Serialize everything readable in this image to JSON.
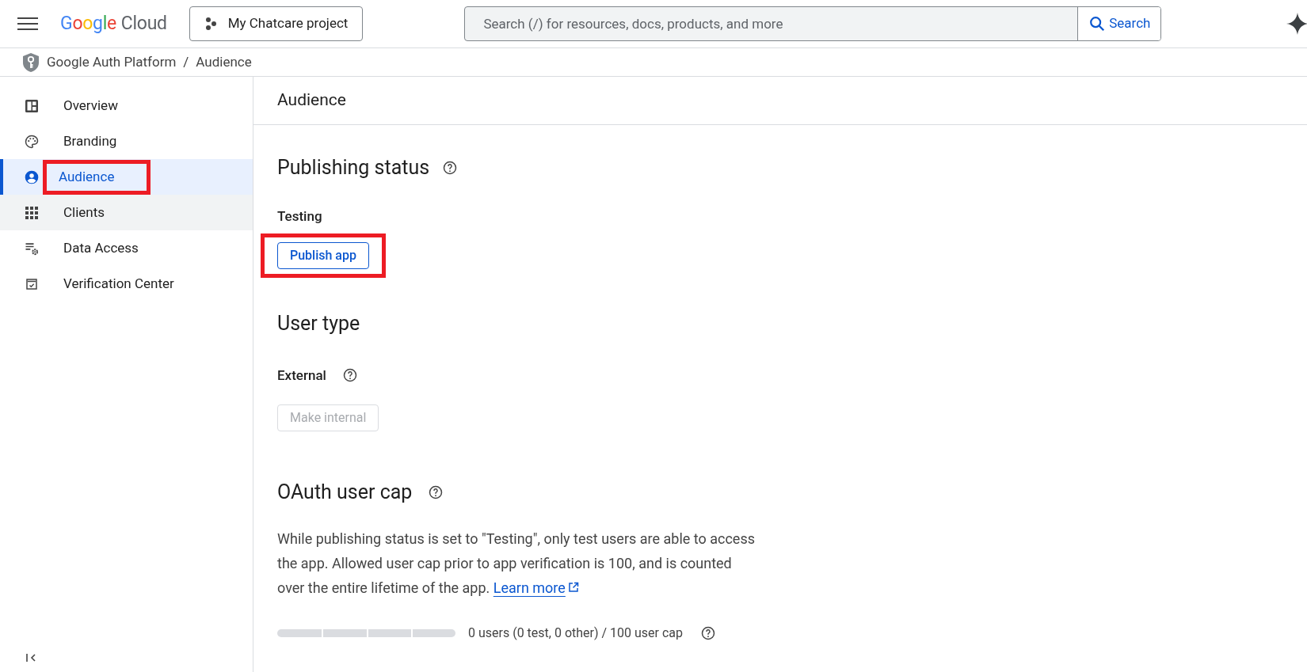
{
  "header": {
    "logo": {
      "brand": "Google",
      "product": "Cloud"
    },
    "project": "My Chatcare project",
    "search": {
      "placeholder": "Search (/) for resources, docs, products, and more",
      "button": "Search"
    }
  },
  "breadcrumb": [
    "Google Auth Platform",
    "/",
    "Audience"
  ],
  "sidebar": {
    "items": [
      {
        "label": "Overview",
        "kind": "overview",
        "selected": false,
        "hovered": false,
        "highlighted": false
      },
      {
        "label": "Branding",
        "kind": "branding",
        "selected": false,
        "hovered": false,
        "highlighted": false
      },
      {
        "label": "Audience",
        "kind": "audience",
        "selected": true,
        "hovered": false,
        "highlighted": true
      },
      {
        "label": "Clients",
        "kind": "clients",
        "selected": false,
        "hovered": true,
        "highlighted": false
      },
      {
        "label": "Data Access",
        "kind": "data",
        "selected": false,
        "hovered": false,
        "highlighted": false
      },
      {
        "label": "Verification Center",
        "kind": "verify",
        "selected": false,
        "hovered": false,
        "highlighted": false
      }
    ]
  },
  "page_title": "Audience",
  "publishing": {
    "heading": "Publishing status",
    "status": "Testing",
    "button": {
      "label": "Publish app",
      "disabled": false,
      "highlighted": true
    }
  },
  "user_type": {
    "heading": "User type",
    "value": "External",
    "button": {
      "label": "Make internal",
      "disabled": true,
      "highlighted": false
    }
  },
  "user_cap": {
    "heading": "OAuth user cap",
    "description": "While publishing status is set to \"Testing\", only test users are able to access the app. Allowed user cap prior to app verification is 100, and is counted over the entire lifetime of the app.",
    "link": "Learn more",
    "level": 0,
    "reading": "0 users (0 test, 0 other) / 100 user cap"
  }
}
